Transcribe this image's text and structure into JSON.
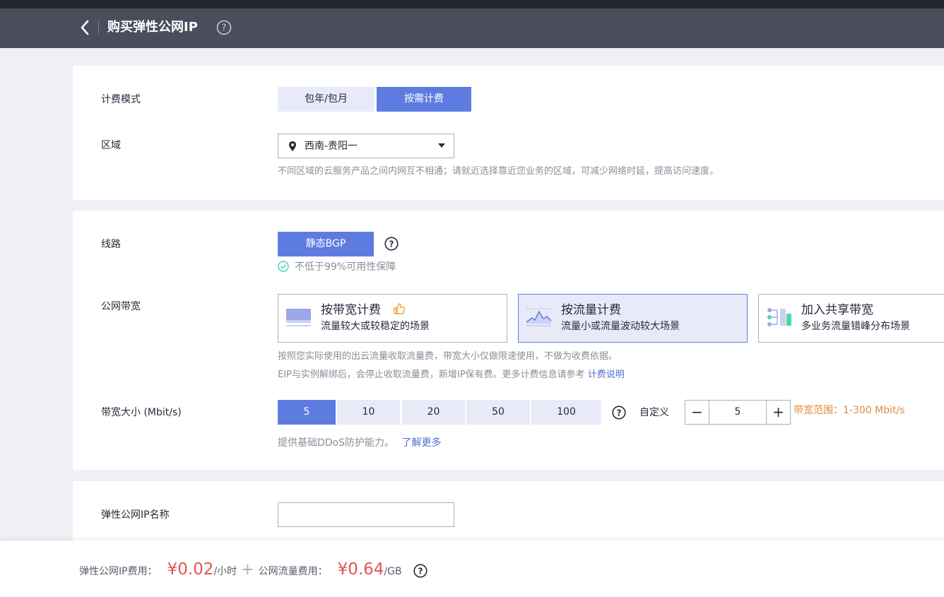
{
  "header": {
    "title": "购买弹性公网IP"
  },
  "billing": {
    "label": "计费模式",
    "options": [
      "包年/包月",
      "按需计费"
    ],
    "selected": "按需计费"
  },
  "region": {
    "label": "区域",
    "value": "西南-贵阳一",
    "hint": "不同区域的云服务产品之间内网互不相通；请就近选择靠近您业务的区域，可减少网络时延，提高访问速度。"
  },
  "line": {
    "label": "线路",
    "button": "静态BGP",
    "guarantee": "不低于99%可用性保障"
  },
  "bandwidth": {
    "label": "公网带宽",
    "options": [
      {
        "title": "按带宽计费",
        "desc": "流量较大或较稳定的场景"
      },
      {
        "title": "按流量计费",
        "desc": "流量小或流量波动较大场景"
      },
      {
        "title": "加入共享带宽",
        "desc": "多业务流量错峰分布场景"
      }
    ],
    "hint1": "按照您实际使用的出云流量收取流量费，带宽大小仅做限速使用，不做为收费依据。",
    "hint2": "EIP与实例解绑后，会停止收取流量费，新增IP保有费。更多计费信息请参考",
    "hint2_link": "计费说明"
  },
  "size": {
    "label": "带宽大小 (Mbit/s)",
    "options": [
      "5",
      "10",
      "20",
      "50",
      "100"
    ],
    "selected": "5",
    "custom_label": "自定义",
    "custom_value": "5",
    "range": "带宽范围：1-300 Mbit/s",
    "ddos_hint": "提供基础DDoS防护能力。",
    "ddos_link": "了解更多"
  },
  "name": {
    "label": "弹性公网IP名称",
    "value": ""
  },
  "footer": {
    "ip_fee_label": "弹性公网IP费用：",
    "ip_fee": "¥0.02",
    "ip_fee_unit": "/小时",
    "traffic_fee_label": "公网流量费用：",
    "traffic_fee": "¥0.64",
    "traffic_fee_unit": "/GB"
  },
  "colors": {
    "primary": "#5e7ce0",
    "price": "#e05555",
    "range": "#e08a3c",
    "header": "#4a4e5c"
  }
}
